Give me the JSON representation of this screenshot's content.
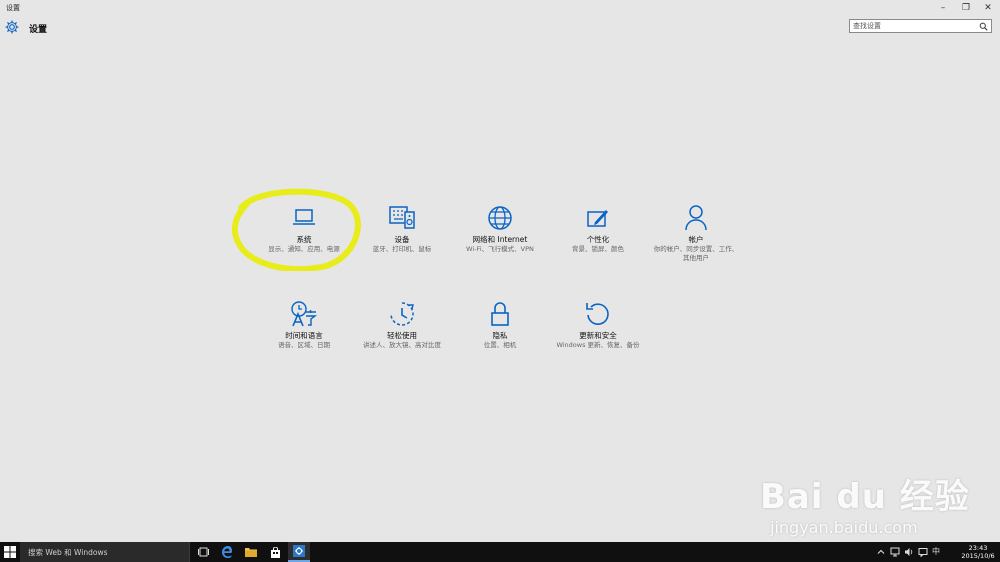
{
  "window": {
    "title": "设置",
    "minimize_glyph": "–",
    "maximize_glyph": "❐",
    "close_glyph": "✕"
  },
  "header": {
    "title": "设置",
    "icon": "gear-icon"
  },
  "search": {
    "placeholder": "查找设置",
    "value": "",
    "icon": "search-icon"
  },
  "tiles": [
    {
      "id": "system",
      "name": "系统",
      "desc": "显示、通知、应用、电源",
      "icon": "laptop-icon"
    },
    {
      "id": "devices",
      "name": "设备",
      "desc": "蓝牙、打印机、鼠标",
      "icon": "keyboard-speaker-icon"
    },
    {
      "id": "network",
      "name": "网络和 Internet",
      "desc": "Wi-Fi、飞行模式、VPN",
      "icon": "globe-icon"
    },
    {
      "id": "personalization",
      "name": "个性化",
      "desc": "背景、锁屏、颜色",
      "icon": "paint-icon"
    },
    {
      "id": "accounts",
      "name": "帐户",
      "desc": "你的帐户、同步设置、工作、其他用户",
      "icon": "person-icon"
    },
    {
      "id": "time-language",
      "name": "时间和语言",
      "desc": "语音、区域、日期",
      "icon": "language-icon"
    },
    {
      "id": "ease-of-access",
      "name": "轻松使用",
      "desc": "讲述人、放大镜、高对比度",
      "icon": "ease-clock-icon"
    },
    {
      "id": "privacy",
      "name": "隐私",
      "desc": "位置、相机",
      "icon": "lock-icon"
    },
    {
      "id": "update-security",
      "name": "更新和安全",
      "desc": "Windows 更新、恢复、备份",
      "icon": "refresh-icon"
    }
  ],
  "watermark": {
    "main": "Bai du 经验",
    "sub": "jingyan.baidu.com"
  },
  "taskbar": {
    "search_text": "搜索 Web 和 Windows",
    "time": "23:43",
    "date": "2015/10/6",
    "accent": "#6aa6e8"
  },
  "colors": {
    "accent": "#0a64c4",
    "background": "#e6e6e6",
    "highlight_circle": "#e8ec1a"
  }
}
